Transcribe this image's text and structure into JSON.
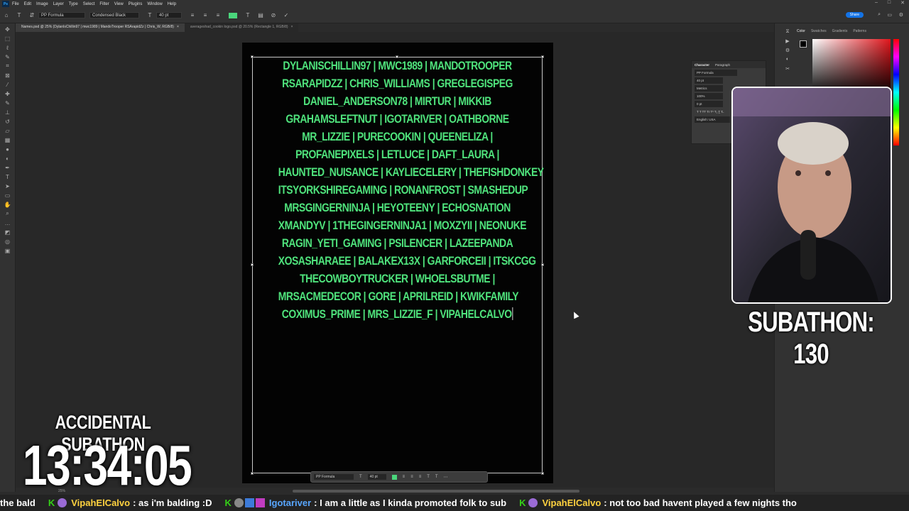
{
  "menubar": {
    "logo": "Ps",
    "items": [
      "File",
      "Edit",
      "Image",
      "Layer",
      "Type",
      "Select",
      "Filter",
      "View",
      "Plugins",
      "Window",
      "Help"
    ]
  },
  "options_bar": {
    "font_family": "PP Formula",
    "font_style": "Condensed Black",
    "font_size": "40 pt",
    "color": "#4ad67c",
    "share_label": "Share"
  },
  "tabs": [
    {
      "label": "Names.psd @ 25% (DylanIsChillin97 | mwc1989 | MandoTrooper  RSArapidZz | Chris_W, RGB/8)",
      "active": true
    },
    {
      "label": "averageshad_cookin logo.psd @ 20.5% (Rectangle 1, RGB/8)",
      "active": false
    }
  ],
  "canvas": {
    "text_color": "#4fe37c",
    "lines": [
      "DYLANISCHILLIN97 | MWC1989 | MANDOTROOPER",
      "RSARAPIDZZ | CHRIS_WILLIAMS | GREGLEGISPEG",
      "DANIEL_ANDERSON78 | MIRTUR | MIKKIB",
      "GRAHAMSLEFTNUT | IGOTARIVER | OATHBORNE",
      "MR_LIZZIE | PURECOOKIN | QUEENELIZA |",
      "PROFANEPIXELS | LETLUCE | DAFT_LAURA |",
      "HAUNTED_NUISANCE | KAYLIECELERY | THEFISHDONKEY",
      "ITSYORKSHIREGAMING | RONANFROST | SMASHEDUP",
      "MRSGINGERNINJA | HEYOTEENY | ECHOSNATION",
      "XMANDYV | 1THEGINGERNINJA1 | MOXZYII | NEONUKE",
      "RAGIN_YETI_GAMING | PSILENCER | LAZEEPANDA",
      "XOSASHARAEE | BALAKEX13X | GARFORCEII | ITSKCGG",
      "THECOWBOYTRUCKER | WHOELSBUTME |",
      "MRSACMEDECOR | GORE | APRILREID | KWIKFAMILY",
      "COXIMUS_PRIME | MRS_LIZZIE_F | VIPAHELCALVO"
    ]
  },
  "context_bar": {
    "font_family": "PP Formula",
    "font_size": "40 pt"
  },
  "status_bar": {
    "zoom": "25%"
  },
  "right_panel": {
    "color_tabs": [
      "Color",
      "Swatches",
      "Gradients",
      "Patterns"
    ],
    "character_panel": {
      "tabs": [
        "Character",
        "Paragraph"
      ],
      "font": "PP Formula",
      "style": "Conden...",
      "size": "40 pt",
      "kerning": "Metrics",
      "scale": "100%",
      "baseline": "0 pt",
      "language": "English: USA"
    }
  },
  "overlay": {
    "subathon_counter": "SUBATHON: 130",
    "title": "ACCIDENTAL SUBATHON",
    "timer": "13:34:05"
  },
  "chat": [
    {
      "type": "fragment",
      "text": "the bald"
    },
    {
      "user": "VipahElCalvo",
      "message": "as i'm balding :D"
    },
    {
      "user": "Igotariver",
      "message": "I am a little as I kinda promoted folk to sub",
      "alt": true
    },
    {
      "user": "VipahElCalvo",
      "message": "not too bad havent played a few nights tho"
    }
  ]
}
